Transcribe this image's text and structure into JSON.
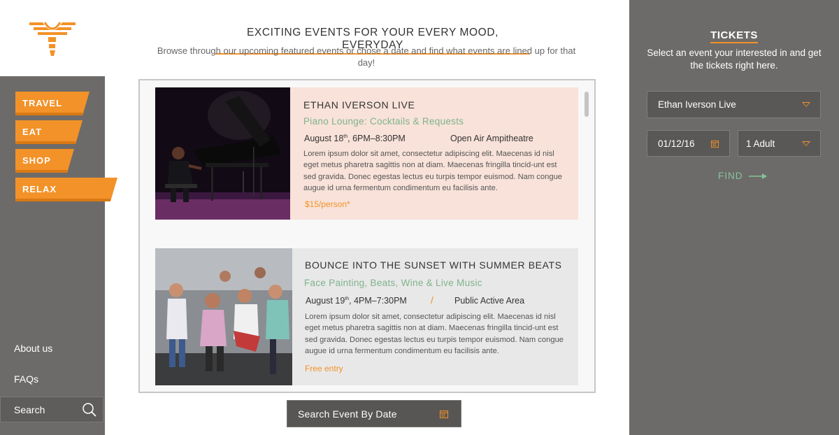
{
  "brand": {
    "logo_icon": "torch-wings-logo-icon",
    "accent": "#f39228"
  },
  "nav": {
    "items": [
      {
        "label": "TRAVEL"
      },
      {
        "label": "EAT"
      },
      {
        "label": "SHOP"
      },
      {
        "label": "RELAX",
        "active": true
      }
    ],
    "links": [
      {
        "label": "About us"
      },
      {
        "label": "FAQs"
      }
    ],
    "search": {
      "label": "Search",
      "icon": "search-icon"
    }
  },
  "main": {
    "title": "EXCITING EVENTS FOR YOUR EVERY MOOD, EVERYDAY",
    "subtitle": "Browse through our upcoming featured events or chose a date and find what events are lined up for that day!",
    "events": [
      {
        "title": "ETHAN IVERSON LIVE",
        "subtitle": "Piano Lounge: Cocktails & Requests",
        "date_day": "August 18",
        "date_suffix": "th",
        "date_time": ", 6PM–8:30PM",
        "venue": "Open Air Ampitheatre",
        "body": "Lorem ipsum dolor sit amet, consectetur adipiscing elit. Maecenas id nisl eget metus pharetra sagittis non at diam. Maecenas fringilla tincid-unt est sed gravida. Donec egestas lectus eu turpis tempor euismod. Nam congue augue id urna fermentum condimentum eu facilisis ante.",
        "price": "$15/person*"
      },
      {
        "title": "BOUNCE INTO THE SUNSET WITH SUMMER BEATS",
        "subtitle": "Face Painting, Beats, Wine & Live Music",
        "date_day": "August 19",
        "date_suffix": "th",
        "date_time": ", 4PM–7:30PM",
        "separator": "/",
        "venue": "Public Active Area",
        "body": "Lorem ipsum dolor sit amet, consectetur adipiscing elit. Maecenas id nisl eget metus pharetra sagittis non at diam. Maecenas fringilla tincid-unt est sed gravida. Donec egestas lectus eu turpis tempor euismod. Nam congue augue id urna fermentum condimentum eu facilisis ante.",
        "price": "Free entry"
      }
    ],
    "date_button": {
      "label": "Search Event By Date",
      "icon": "calendar-icon"
    }
  },
  "tickets": {
    "title": "TICKETS",
    "subtitle": "Select an event your interested in and get the tickets right here.",
    "event_select": "Ethan Iverson Live",
    "date_value": "01/12/16",
    "guests_select": "1 Adult",
    "find_label": "FIND"
  }
}
